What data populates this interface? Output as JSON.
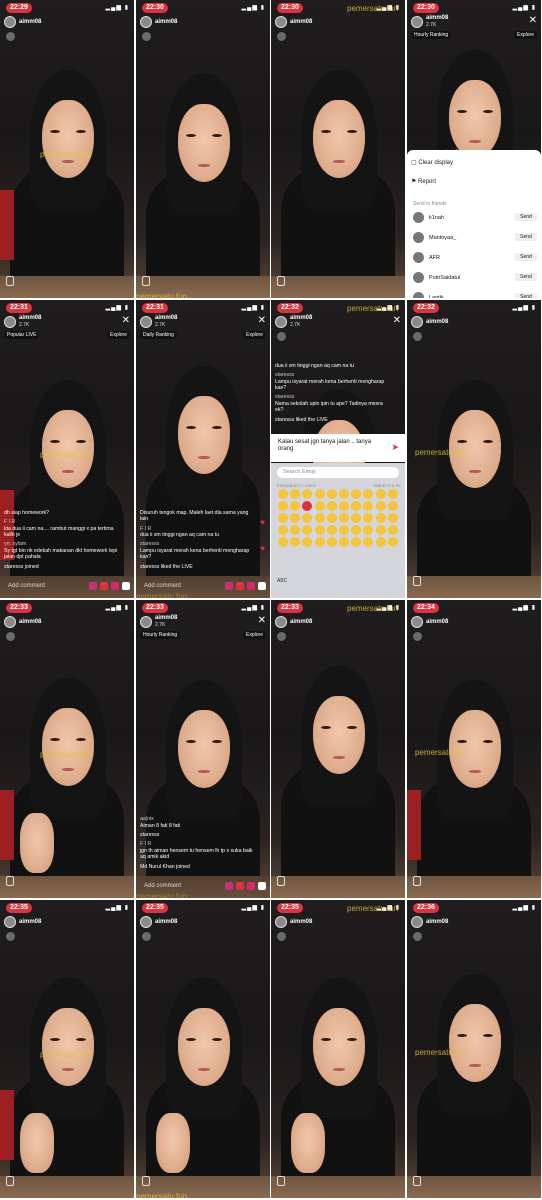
{
  "watermark": "pemersatu.fun",
  "host": {
    "name": "aimm08",
    "likes": "2.7K"
  },
  "comment_placeholder": "Add comment",
  "cells": [
    {
      "time": "22:29",
      "pose": "smile",
      "explore": "",
      "ranking": "",
      "comments": []
    },
    {
      "time": "22:30",
      "pose": "up",
      "explore": "",
      "ranking": "",
      "comments": []
    },
    {
      "time": "22:30",
      "pose": "smile",
      "explore": "",
      "ranking": "",
      "comments": []
    },
    {
      "time": "22:30",
      "pose": "panel",
      "explore": "Explore",
      "ranking": "Hourly Ranking",
      "comments": []
    },
    {
      "time": "22:31",
      "pose": "down",
      "explore": "Explore",
      "ranking": "Popular LIVE",
      "viewers": "22",
      "comments": [
        {
          "user": "",
          "text": "dh siap homework?"
        },
        {
          "user": "F I R",
          "text": "kta dua ii cam na.... rambut manggi x pa tertima kalih je"
        },
        {
          "user": "yrr. sylam",
          "text": "Sy tgt bin nk edekah makanan dkt homework tepi jalan dpt pahala"
        },
        {
          "user": "",
          "text": "staresss joined"
        }
      ]
    },
    {
      "time": "22:31",
      "pose": "side",
      "explore": "Explore",
      "ranking": "Daily Ranking",
      "viewers": "23",
      "music": "Musica Mania",
      "comments": [
        {
          "user": "",
          "text": "Disuruh tengok map. Maleh laet dia sama yang lain"
        },
        {
          "user": "F I R",
          "text": "dua ii sm tinggi ngan aq cam na tu"
        },
        {
          "user": "staresss",
          "text": "Lampu isyarat merah kena berhenti mengharap kan?"
        },
        {
          "user": "",
          "text": "staresss liked the LIVE"
        }
      ]
    },
    {
      "time": "22:32",
      "pose": "keyboard",
      "explore": "",
      "ranking": "",
      "comments": [
        {
          "user": "",
          "text": "dua ii sm tinggi ngan aq cam na tu"
        },
        {
          "user": "staresss",
          "text": "Lampu isyarat merah kena berhenti mengharap kan?"
        },
        {
          "user": "staresss",
          "text": "Nama sekolah upin ipin tu ape? Tadinya mesra ek?"
        },
        {
          "user": "",
          "text": "staresss liked the LIVE"
        }
      ],
      "typed": "Kalau sesat jgn tanya jalan .. tanya orang",
      "emoji_search": "Search Emoji",
      "frequent_label": "FREQUENTLY USED",
      "smileys_label": "SMILEYS & PE",
      "abc": "ABC"
    },
    {
      "time": "22:32",
      "pose": "down",
      "explore": "",
      "ranking": "",
      "comments": []
    },
    {
      "time": "22:33",
      "pose": "hand",
      "explore": "",
      "ranking": "",
      "comments": []
    },
    {
      "time": "22:33",
      "pose": "down",
      "explore": "Explore",
      "ranking": "Hourly Ranking",
      "comments": [
        {
          "user": "aa|nix",
          "text": "Aiman 8 fati 8 fati"
        },
        {
          "user": "",
          "text": "staresss"
        },
        {
          "user": "F I R",
          "text": "jgn th aiman hensem tu hensem lh tp x suka baik aq amik akid"
        },
        {
          "user": "",
          "text": "Md Nurul Khan joined"
        }
      ]
    },
    {
      "time": "22:33",
      "pose": "side",
      "explore": "",
      "ranking": "",
      "comments": []
    },
    {
      "time": "22:34",
      "pose": "down",
      "explore": "",
      "ranking": "",
      "comments": []
    },
    {
      "time": "22:35",
      "pose": "hand",
      "explore": "",
      "ranking": "",
      "comments": []
    },
    {
      "time": "22:35",
      "pose": "hand",
      "explore": "",
      "ranking": "",
      "comments": []
    },
    {
      "time": "22:35",
      "pose": "hand",
      "explore": "",
      "ranking": "",
      "comments": []
    },
    {
      "time": "22:36",
      "pose": "up",
      "explore": "",
      "ranking": "",
      "comments": []
    }
  ],
  "panel": {
    "clear_display": "Clear display",
    "report": "Report",
    "send_to_friends": "Send to friends",
    "send_label": "Send",
    "friends": [
      "k1nah",
      "Mantoyaa_",
      "AFR",
      "PutriSaidatul",
      "Lantik"
    ]
  }
}
